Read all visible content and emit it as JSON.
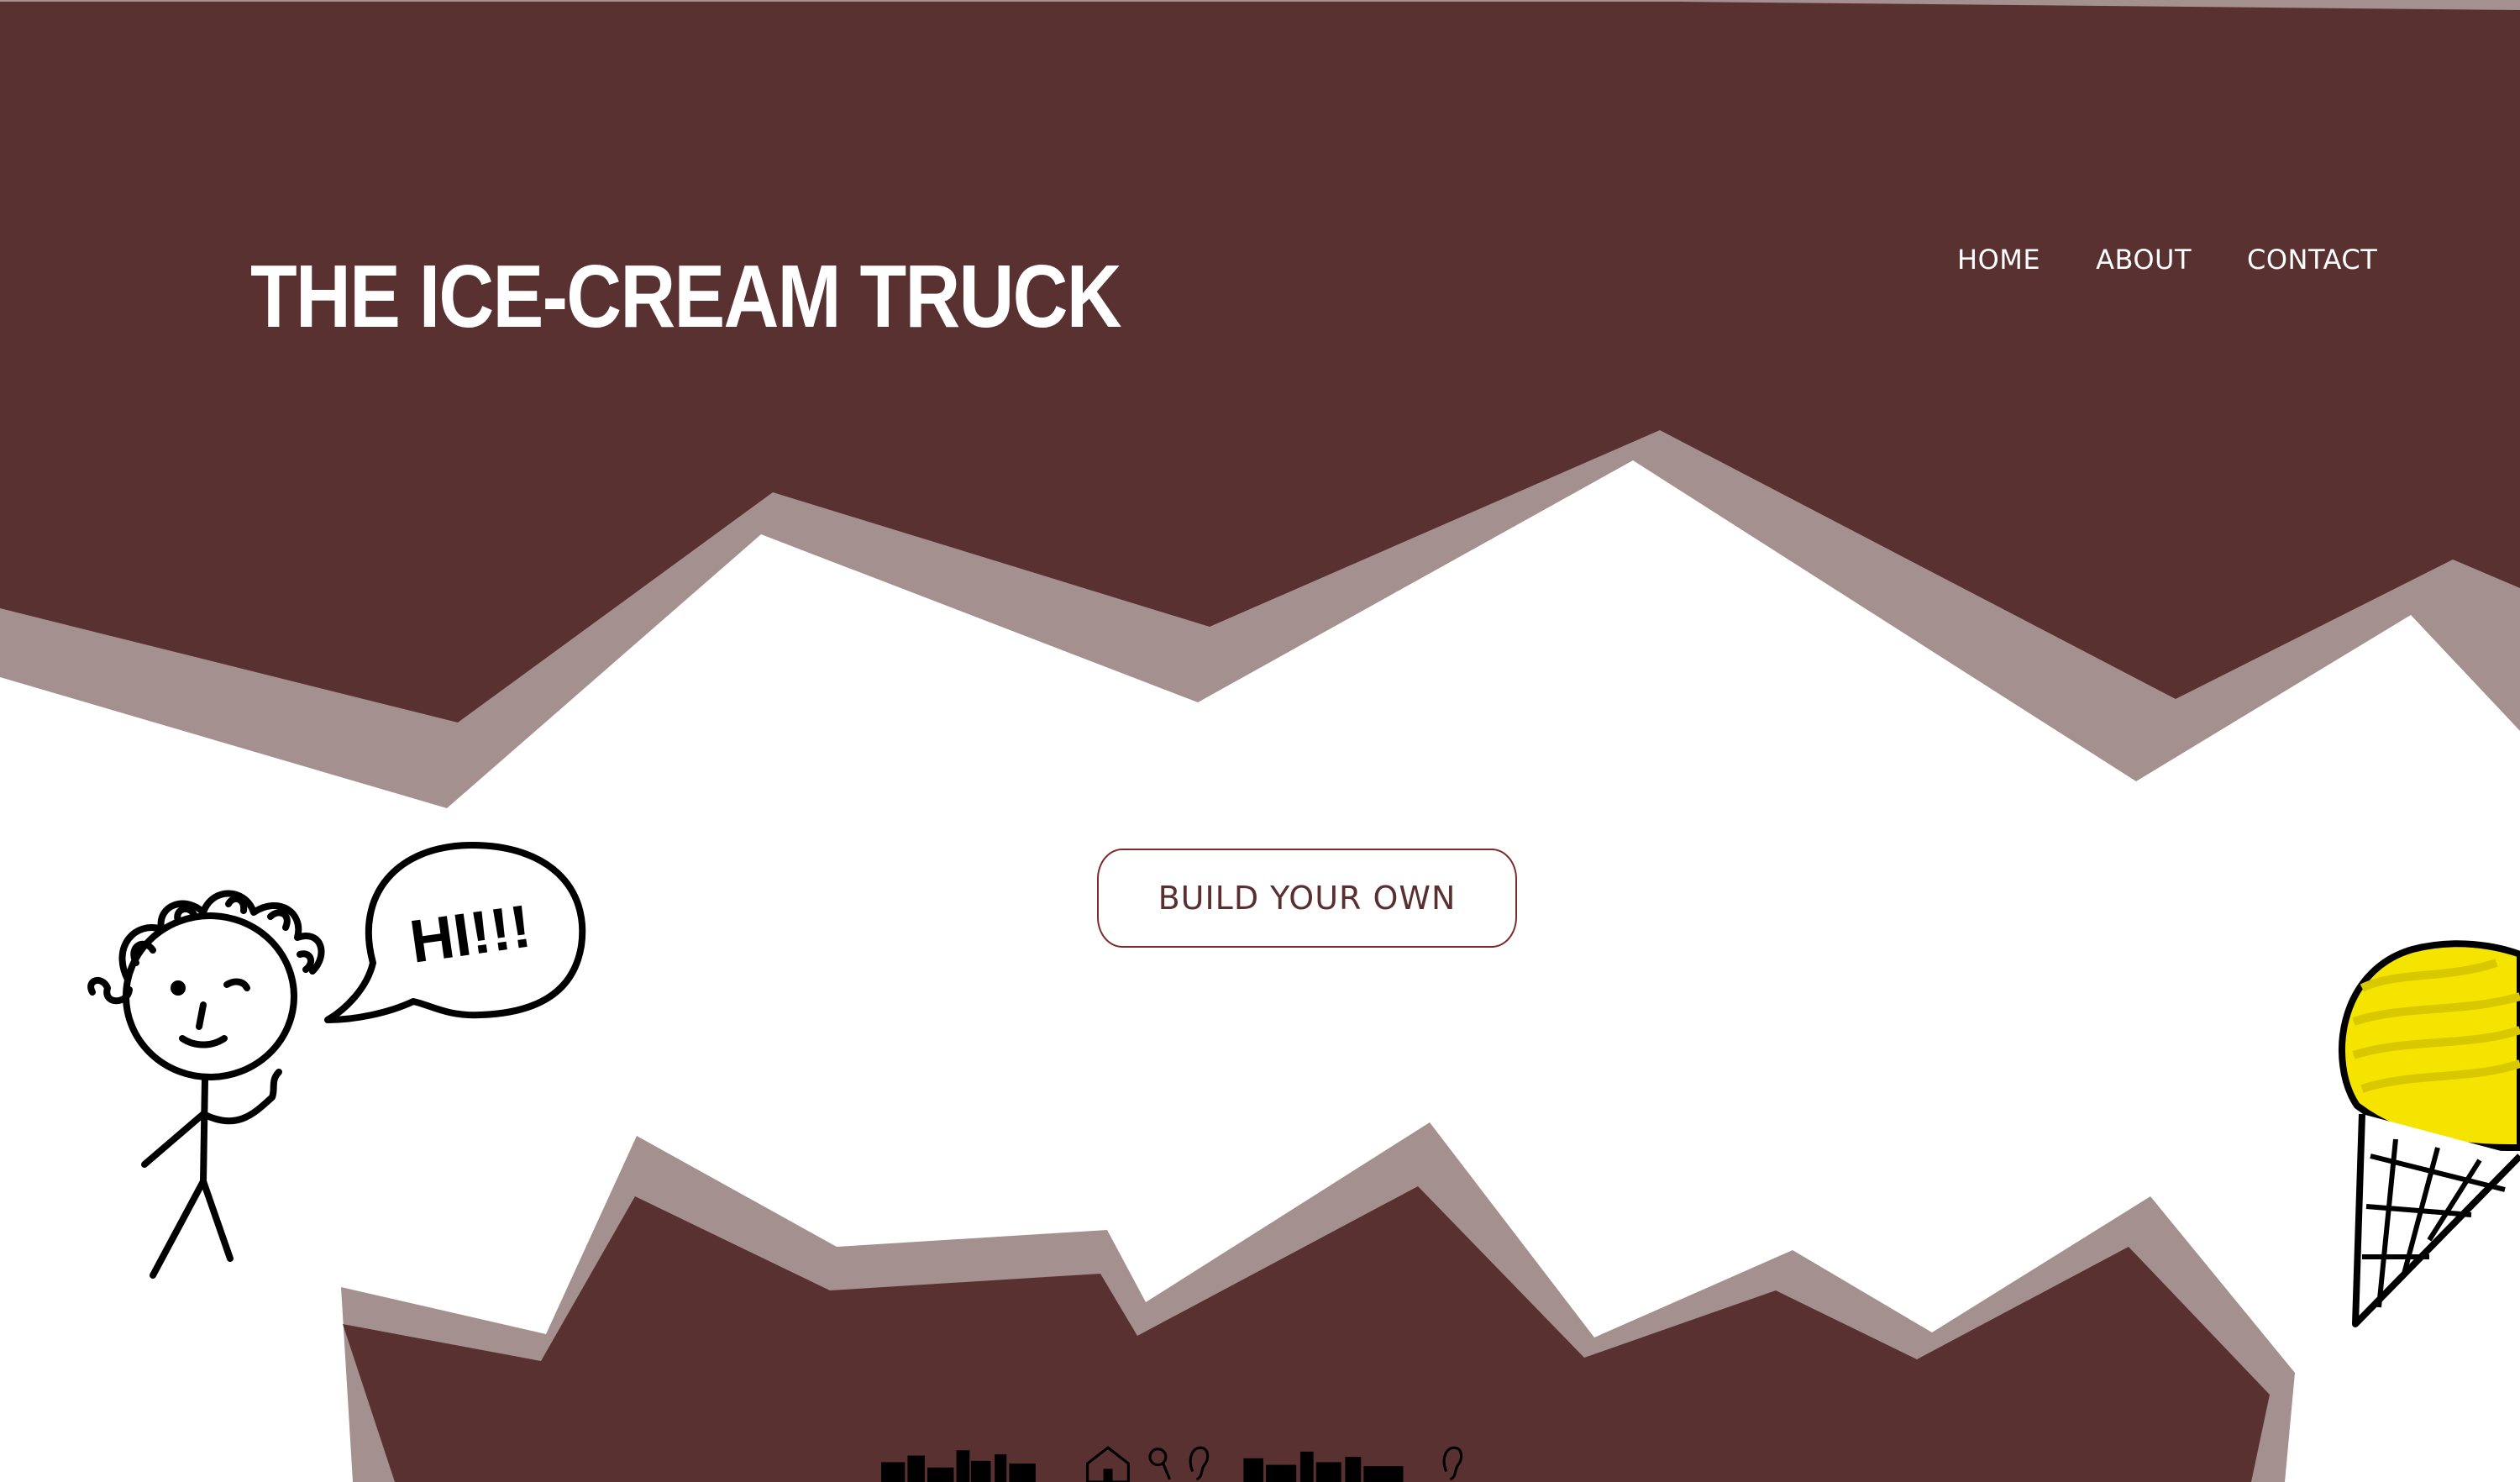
{
  "header": {
    "title": "THE ICE-CREAM TRUCK",
    "nav": [
      {
        "label": "HOME"
      },
      {
        "label": "ABOUT"
      },
      {
        "label": "CONTACT"
      }
    ]
  },
  "main": {
    "cta_label": "BUILD YOUR OWN",
    "speech_bubble_text": "HI!!!"
  },
  "colors": {
    "brown": "#5a3131",
    "brown_shadow": "#a59090",
    "white": "#ffffff",
    "ice_cream_yellow": "#f5e400",
    "button_border": "#7d2a2a"
  },
  "icons": [
    "stickman-icon",
    "speech-bubble-icon",
    "ice-cream-cone-icon",
    "city-skyline-icon",
    "house-icon",
    "ear-icon",
    "magnifier-icon"
  ]
}
